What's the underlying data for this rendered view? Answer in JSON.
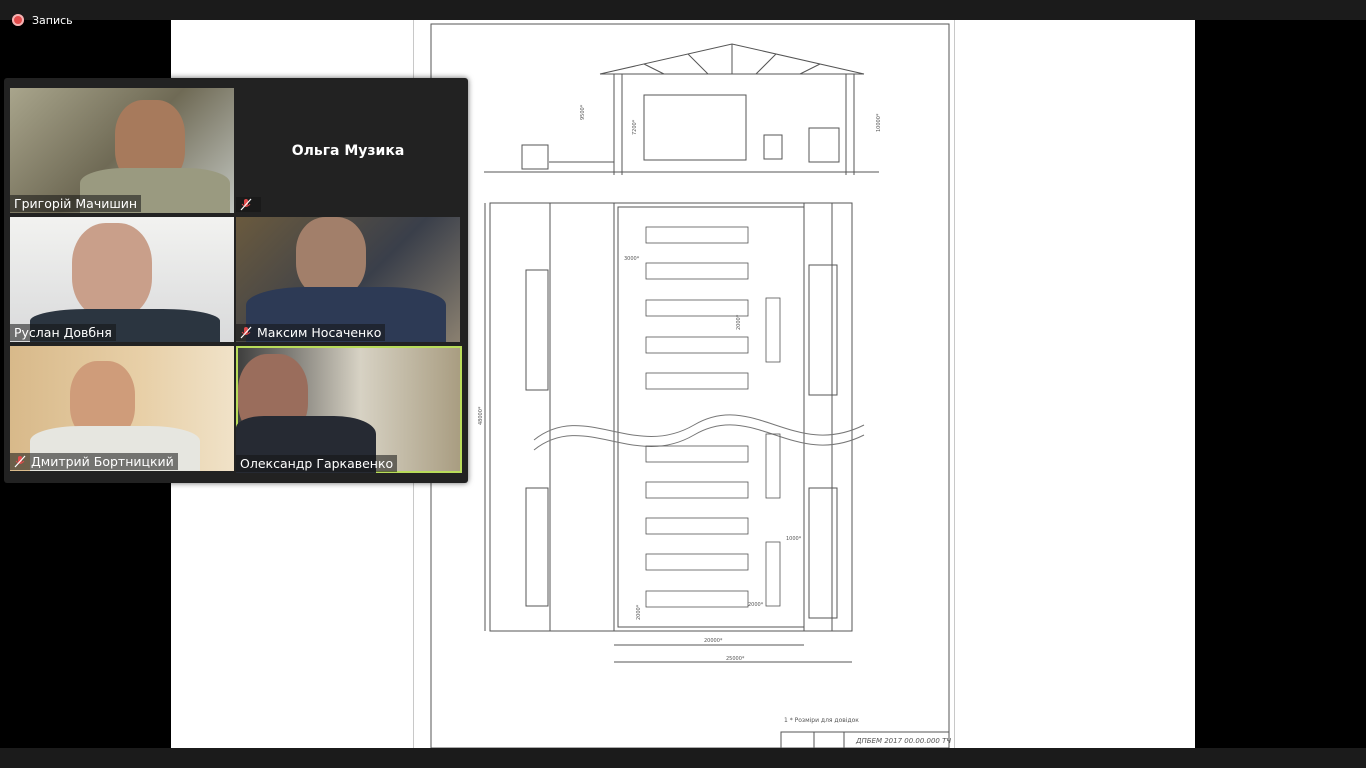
{
  "recording": {
    "label": "Запись"
  },
  "participants": [
    {
      "name": "Григорій Мачишин",
      "video": true,
      "muted": false
    },
    {
      "name": "Ольга Музика",
      "video": false,
      "muted": true
    },
    {
      "name": "Руслан Довбня",
      "video": true,
      "muted": false
    },
    {
      "name": "Максим Носаченко",
      "video": true,
      "muted": true
    },
    {
      "name": "Дмитрий Бортницкий",
      "video": true,
      "muted": true
    },
    {
      "name": "Олександр Гаркавенко",
      "video": true,
      "muted": false,
      "speaking": true
    }
  ],
  "drawing": {
    "dims": {
      "height1": "9500*",
      "height2": "7200*",
      "height3": "10000*",
      "aisle": "3000*",
      "gap": "2000*",
      "length": "48000*",
      "span1": "20000*",
      "span2": "25000*",
      "small1": "1000*",
      "small2": "2000*",
      "small3": "2000*"
    },
    "note": "1  * Розміри для довідок",
    "stamp": "ДПБЕМ 2017 00.00.000 ТЧ"
  },
  "colors": {
    "accent_speaking": "#b9dc5a",
    "record": "#e24b4b",
    "muted_icon": "#e24b4b"
  }
}
